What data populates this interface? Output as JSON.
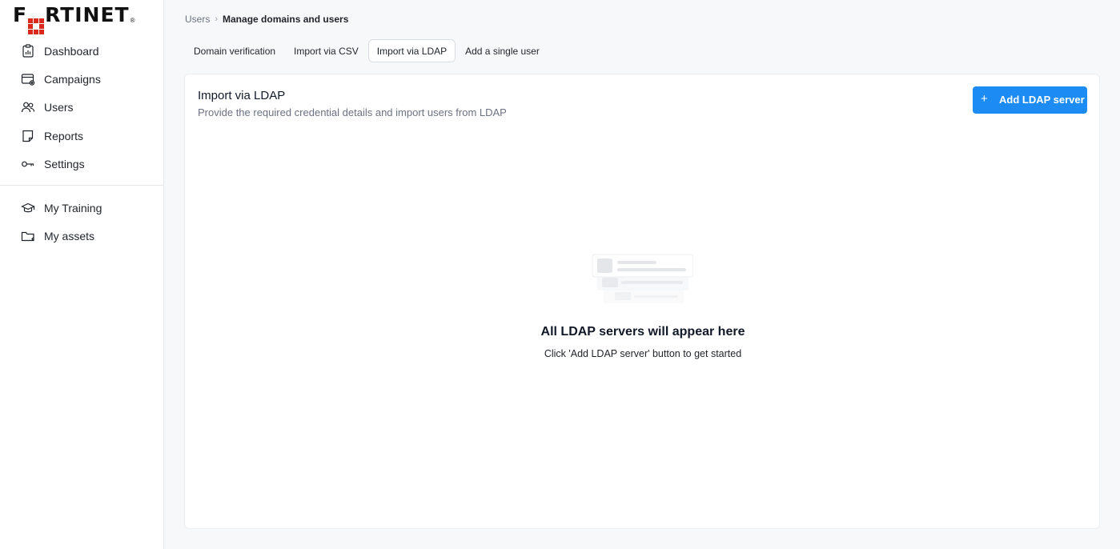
{
  "brand": {
    "logo_text": "FORTINET",
    "accent": "#da291c"
  },
  "sidebar": {
    "items": [
      {
        "label": "Dashboard",
        "icon": "dashboard-icon"
      },
      {
        "label": "Campaigns",
        "icon": "campaigns-icon"
      },
      {
        "label": "Users",
        "icon": "users-icon"
      },
      {
        "label": "Reports",
        "icon": "reports-icon"
      },
      {
        "label": "Settings",
        "icon": "settings-icon"
      }
    ],
    "secondary_items": [
      {
        "label": "My Training",
        "icon": "graduation-cap-icon"
      },
      {
        "label": "My assets",
        "icon": "folder-icon"
      }
    ]
  },
  "breadcrumb": {
    "root": "Users",
    "current": "Manage domains and users"
  },
  "tabs": [
    {
      "label": "Domain verification",
      "active": false
    },
    {
      "label": "Import via CSV",
      "active": false
    },
    {
      "label": "Import via LDAP",
      "active": true
    },
    {
      "label": "Add a single user",
      "active": false
    }
  ],
  "card": {
    "title": "Import via LDAP",
    "subtitle": "Provide the required credential details and import users from LDAP",
    "add_button": {
      "label": "Add LDAP server",
      "icon": "plus-icon",
      "color": "#1c8cf4"
    }
  },
  "empty_state": {
    "title": "All LDAP servers will appear here",
    "subtitle": "Click 'Add LDAP server' button to get started"
  }
}
